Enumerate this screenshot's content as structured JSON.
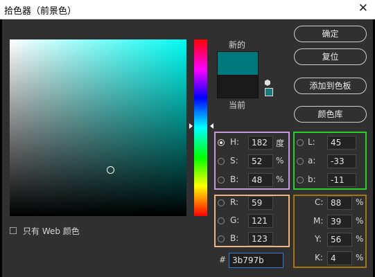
{
  "title": "拾色器（前景色）",
  "labels": {
    "new": "新的",
    "current": "当前"
  },
  "buttons": {
    "ok": "确定",
    "reset": "复位",
    "add_to_swatches": "添加到色板",
    "color_libraries": "颜色库"
  },
  "web_only": "只有 Web 颜色",
  "hsb": {
    "h_label": "H:",
    "h_value": "182",
    "h_unit": "度",
    "s_label": "S:",
    "s_value": "52",
    "s_unit": "%",
    "b_label": "B:",
    "b_value": "48",
    "b_unit": "%"
  },
  "lab": {
    "l_label": "L:",
    "l_value": "45",
    "a_label": "a:",
    "a_value": "-33",
    "b_label": "b:",
    "b_value": "-11"
  },
  "rgb": {
    "r_label": "R:",
    "r_value": "59",
    "g_label": "G:",
    "g_value": "121",
    "b_label": "B:",
    "b_value": "123"
  },
  "cmyk": {
    "c_label": "C:",
    "c_value": "88",
    "m_label": "M:",
    "m_value": "39",
    "y_label": "Y:",
    "y_value": "56",
    "k_label": "K:",
    "k_value": "4",
    "unit": "%"
  },
  "hex": {
    "label": "#",
    "value": "3b797b"
  },
  "colors": {
    "new_color": "#00797d",
    "current_color": "#1a1a1a",
    "hue_color": "#00fbf3"
  },
  "icons": {
    "close": "close-icon",
    "cube": "cube-icon"
  }
}
